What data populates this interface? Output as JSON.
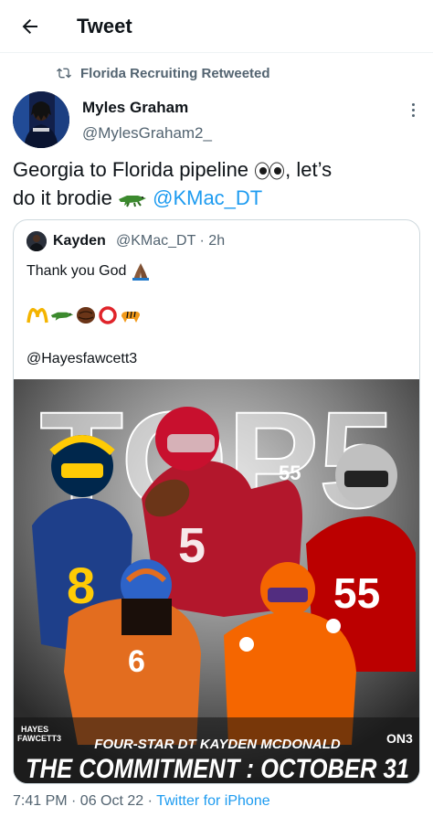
{
  "header": {
    "title": "Tweet"
  },
  "retweet": {
    "text": "Florida Recruiting Retweeted"
  },
  "author": {
    "name": "Myles Graham",
    "handle": "@MylesGraham2_"
  },
  "tweet": {
    "text_part1": "Georgia to Florida pipeline",
    "text_part2": ", let’s",
    "text_part3": "do it brodie",
    "mention": "@KMac_DT"
  },
  "quote": {
    "name": "Kayden",
    "meta": "@KMac_DT · 2h",
    "line1": "Thank you God",
    "line3": "@Hayesfawcett3",
    "image": {
      "big_text": "TOP5",
      "watermark_line1": "HAYES",
      "watermark_line2": "FAWCETT3",
      "brand": "ON3",
      "caption": "FOUR-STAR DT KAYDEN MCDONALD",
      "headline": "THE COMMITMENT : OCTOBER 31",
      "jersey_numbers": [
        "8",
        "55",
        "55",
        "6"
      ]
    }
  },
  "footer": {
    "time": "7:41 PM · 06 Oct 22 · ",
    "source": "Twitter for iPhone"
  },
  "icons": [
    "back-arrow-icon",
    "retweet-icon",
    "more-icon",
    "eyes-emoji",
    "alligator-emoji",
    "praying-hands-emoji",
    "m-arch-emoji",
    "football-emoji",
    "circle-emoji",
    "tiger-emoji"
  ],
  "colors": {
    "link": "#1d9bf0",
    "secondary": "#536471"
  }
}
